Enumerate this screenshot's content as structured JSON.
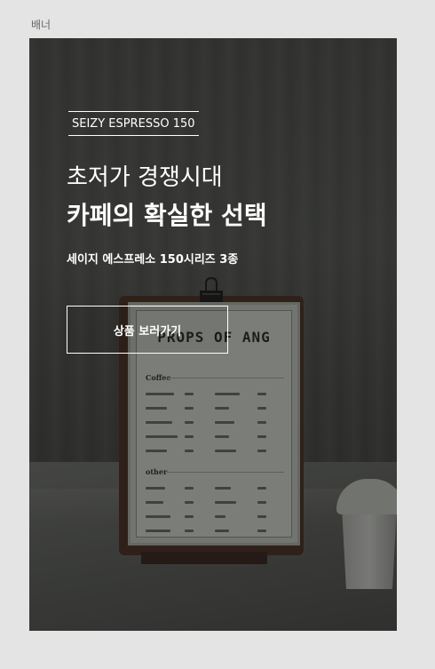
{
  "section_label": "배너",
  "banner": {
    "brand_label": "SEIZY ESPRESSO 150",
    "headline_line1": "초저가 경쟁시대",
    "headline_line2": "카페의 확실한 선택",
    "subheadline": "세이지 에스프레소 150시리즈 3종",
    "cta_label": "상품 보러가기"
  },
  "photo": {
    "menu_title": "PROPS OF ANG",
    "menu_sections": [
      "Coffee",
      "other"
    ]
  }
}
